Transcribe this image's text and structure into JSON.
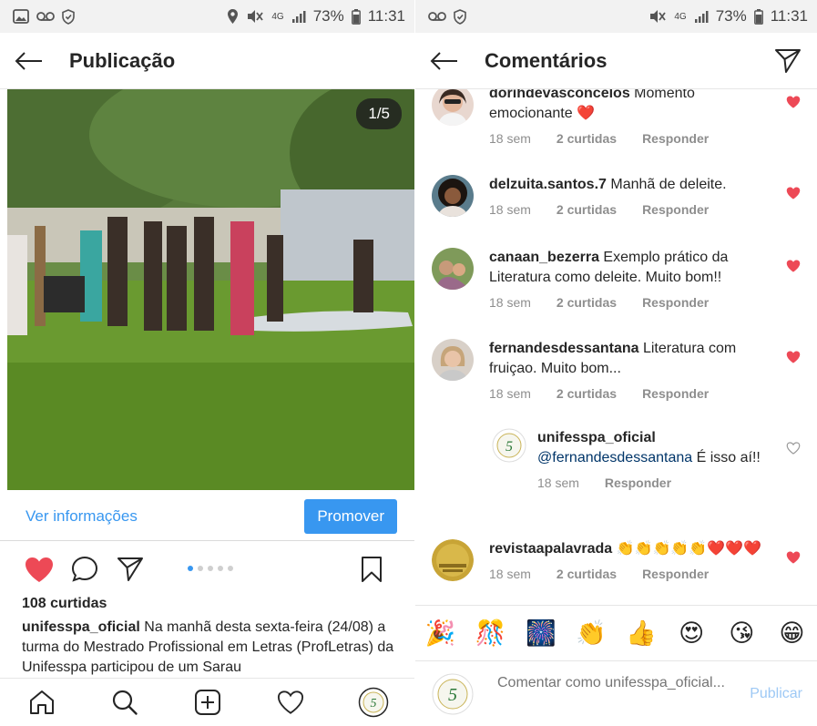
{
  "left": {
    "status": {
      "battery": "73%",
      "time": "11:31",
      "network": "4G"
    },
    "appbar": {
      "title": "Publicação"
    },
    "photo": {
      "counter": "1/5"
    },
    "info_link": "Ver informações",
    "promote": "Promover",
    "likes": "108 curtidas",
    "caption": {
      "username": "unifesspa_oficial",
      "text": " Na manhã desta sexta-feira (24/08) a turma do Mestrado Profissional em Letras (ProfLetras) da Unifesspa participou de um Sarau"
    }
  },
  "right": {
    "status": {
      "battery": "73%",
      "time": "11:31",
      "network": "4G"
    },
    "appbar": {
      "title": "Comentários"
    },
    "comments": [
      {
        "user": "dorihdevasconcelos",
        "text": " Momento emocionante ❤️",
        "time": "18 sem",
        "likes": "2 curtidas",
        "reply": "Responder"
      },
      {
        "user": "delzuita.santos.7",
        "text": " Manhã de deleite.",
        "time": "18 sem",
        "likes": "2 curtidas",
        "reply": "Responder"
      },
      {
        "user": "canaan_bezerra",
        "text": " Exemplo prático da Literatura como deleite. Muito bom!!",
        "time": "18 sem",
        "likes": "2 curtidas",
        "reply": "Responder"
      },
      {
        "user": "fernandesdessantana",
        "text": " Literatura com fruiçao. Muito bom...",
        "time": "18 sem",
        "likes": "2 curtidas",
        "reply": "Responder"
      },
      {
        "user": "unifesspa_oficial",
        "mention": "@fernandesdessantana",
        "text": " É isso aí!!",
        "time": "18 sem",
        "reply": "Responder"
      },
      {
        "user": "revistaapalavrada",
        "text": " 👏👏👏👏👏❤️❤️❤️",
        "time": "18 sem",
        "likes": "2 curtidas",
        "reply": "Responder"
      }
    ],
    "emojis": [
      "🎉",
      "🎊",
      "🎆",
      "👏",
      "👍",
      "😍",
      "😘",
      "😁"
    ],
    "comment_box": {
      "placeholder": "Comentar como unifesspa_oficial...",
      "publish": "Publicar"
    }
  },
  "colors": {
    "accent": "#3897f0",
    "like": "#ed4956"
  }
}
